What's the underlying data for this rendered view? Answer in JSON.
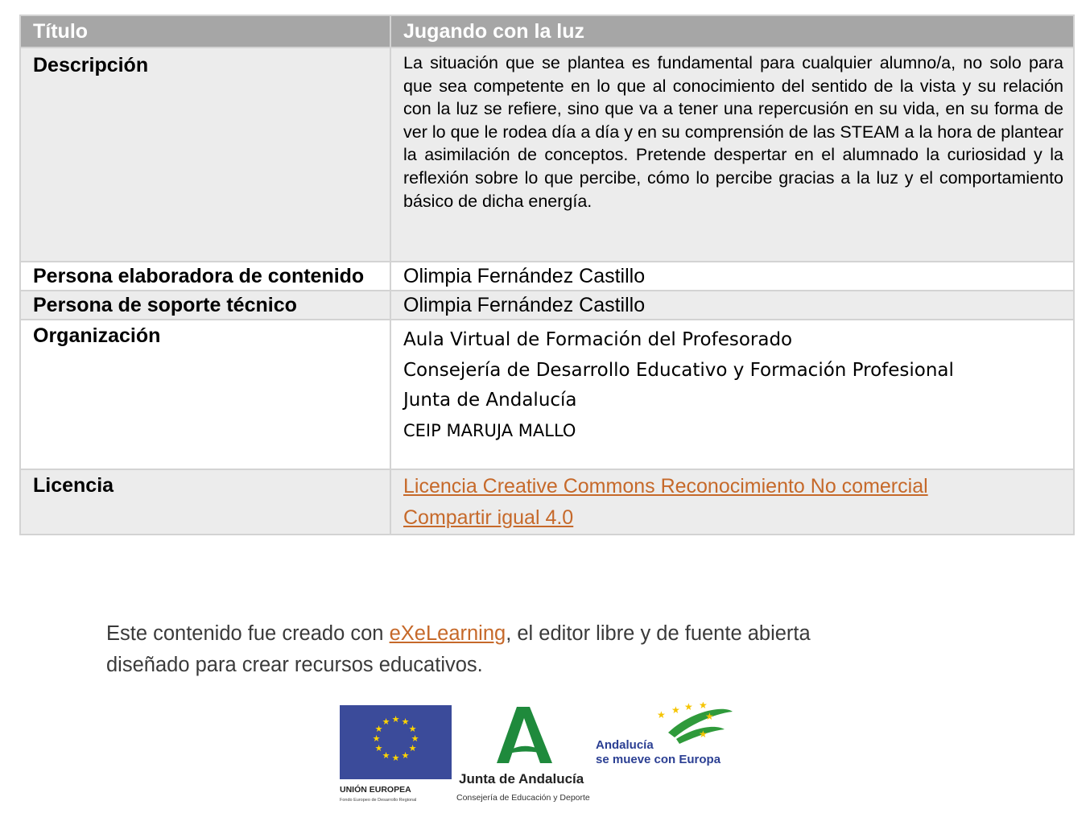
{
  "table": {
    "header": {
      "key": "Título",
      "value": "Jugando con la luz"
    },
    "description": {
      "key": "Descripción",
      "value": "La situación que se plantea es fundamental para cualquier alumno/a, no solo para que sea competente en lo que al conocimiento del sentido de la vista y su relación con la luz se refiere, sino que va a tener una repercusión en su vida, en su forma de ver lo que le rodea día a día y en su comprensión de las STEAM a la hora de plantear la asimilación de conceptos. Pretende despertar en el alumnado la curiosidad y la reflexión sobre lo que percibe, cómo lo percibe gracias a la luz y el comportamiento básico de dicha energía."
    },
    "author": {
      "key": "Persona elaboradora de contenido",
      "value": "Olimpia Fernández Castillo"
    },
    "support": {
      "key": "Persona de soporte técnico",
      "value": "Olimpia Fernández Castillo"
    },
    "organization": {
      "key": "Organización",
      "lines": [
        "Aula Virtual de Formación del Profesorado",
        "Consejería de Desarrollo Educativo y Formación Profesional",
        "Junta de Andalucía",
        "CEIP MARUJA MALLO"
      ]
    },
    "license": {
      "key": "Licencia",
      "line1": "Licencia Creative Commons Reconocimiento No comercial",
      "line2": "Compartir igual 4.0"
    }
  },
  "footer": {
    "text_before": "Este contenido fue creado con ",
    "link": "eXeLearning",
    "text_after": ", el editor libre y de fuente abierta",
    "line2": "diseñado para crear recursos educativos."
  },
  "logos": {
    "eu_title": "UNIÓN EUROPEA",
    "eu_subtitle": "Fondo Europeo de Desarrollo Regional",
    "junta_title": "Junta de Andalucía",
    "junta_subtitle": "Consejería de Educación y Deporte",
    "andalucia_line1": "Andalucía",
    "andalucia_line2": "se mueve con Europa"
  },
  "colors": {
    "header_bg": "#a6a6a6",
    "row_grey": "#ececec",
    "link": "#c6692a",
    "eu_blue": "#3b4b9a",
    "junta_green": "#1f8a3c"
  }
}
